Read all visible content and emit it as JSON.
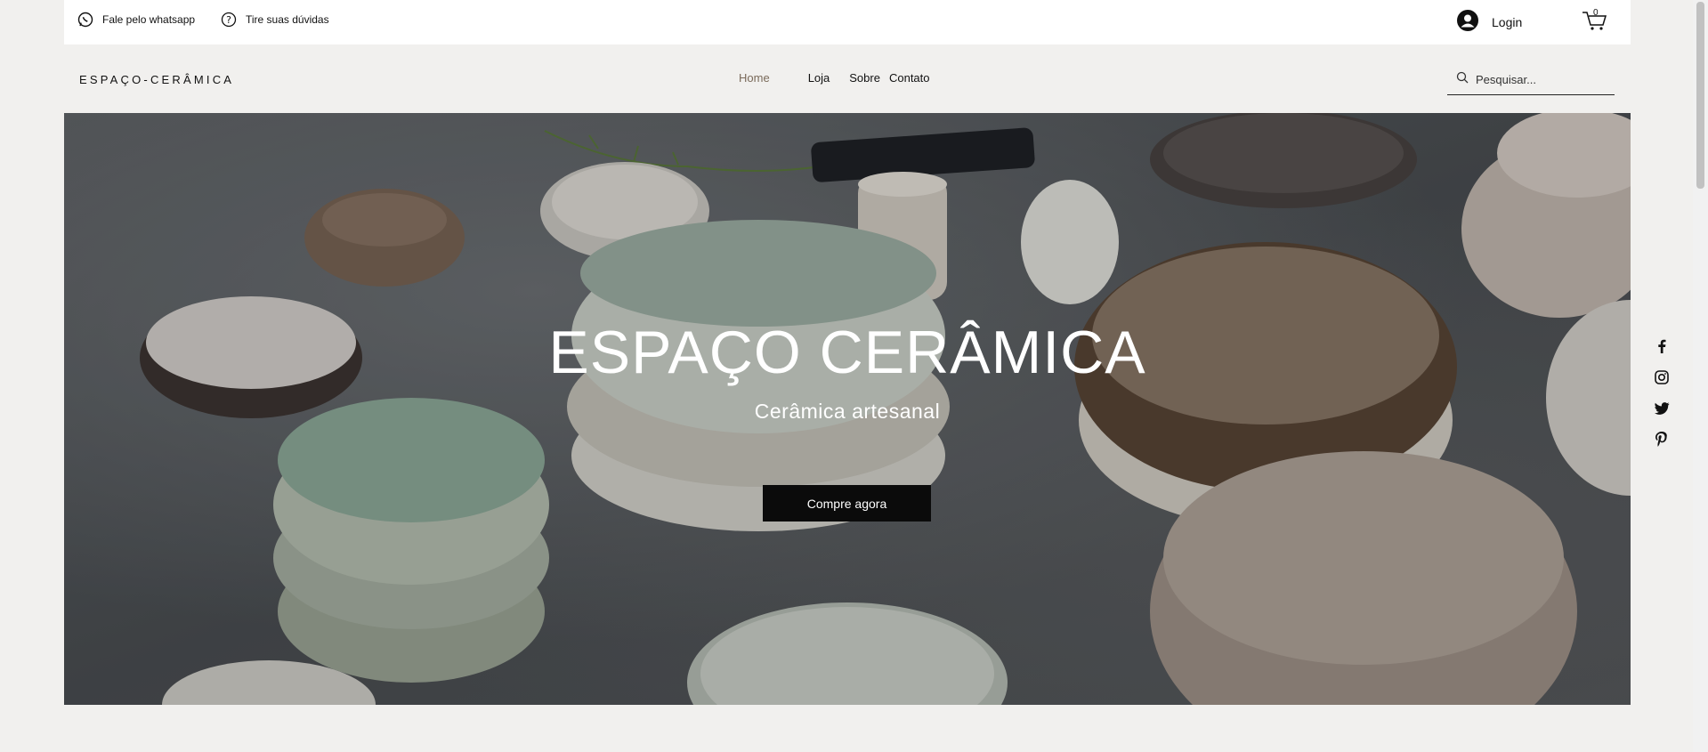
{
  "topbar": {
    "whatsapp_label": "Fale pelo whatsapp",
    "faq_label": "Tire suas dúvidas",
    "login_label": "Login",
    "cart_count": "0"
  },
  "header": {
    "logo": "ESPAÇO-CERÂMICA",
    "nav": [
      {
        "label": "Home",
        "active": true
      },
      {
        "label": "Loja"
      },
      {
        "label": "Sobre"
      },
      {
        "label": "Contato"
      }
    ],
    "search_placeholder": "Pesquisar..."
  },
  "hero": {
    "title": "ESPAÇO CERÂMICA",
    "subtitle": "Cerâmica artesanal",
    "cta_label": "Compre agora"
  },
  "social": [
    "facebook-icon",
    "instagram-icon",
    "twitter-icon",
    "pinterest-icon"
  ],
  "colors": {
    "background": "#f1f0ee",
    "accent_nav_active": "#7a6a5a",
    "button": "#0b0b0b"
  }
}
